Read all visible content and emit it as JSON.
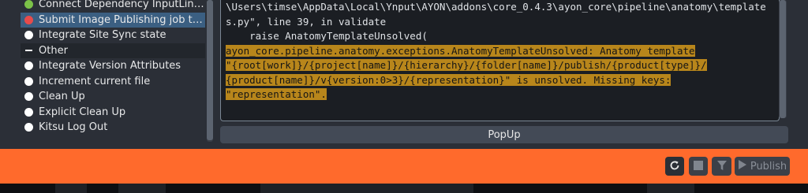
{
  "plugins": [
    {
      "label": "Connect Dependency InputLinks ...",
      "state": "success",
      "color": "#7bc148"
    },
    {
      "label": "Submit Image Publishing job to D...",
      "state": "error",
      "color": "#e84b4b",
      "selected": true
    },
    {
      "label": "Integrate Site Sync state",
      "state": "pending",
      "color": "#ffffff"
    },
    {
      "label": "Other",
      "state": "group",
      "color": "#ffffff",
      "current": true
    },
    {
      "label": "Integrate Version Attributes",
      "state": "pending",
      "color": "#ffffff"
    },
    {
      "label": "Increment current file",
      "state": "pending",
      "color": "#ffffff"
    },
    {
      "label": "Clean Up",
      "state": "pending",
      "color": "#ffffff"
    },
    {
      "label": "Explicit Clean Up",
      "state": "pending",
      "color": "#ffffff"
    },
    {
      "label": "Kitsu Log Out",
      "state": "pending",
      "color": "#ffffff"
    }
  ],
  "log": {
    "lines": [
      {
        "text": "\\Users\\timse\\AppData\\Local\\Ynput\\AYON\\addons\\core_0.4.3\\ayon_core\\pipeline\\anatomy\\template",
        "highlight": false
      },
      {
        "text": "s.py\", line 39, in validate",
        "highlight": false
      },
      {
        "text": "    raise AnatomyTemplateUnsolved(",
        "highlight": false
      },
      {
        "text": "ayon_core.pipeline.anatomy.exceptions.AnatomyTemplateUnsolved: Anatomy template",
        "highlight": true
      },
      {
        "text": "\"{root[work]}/{project[name]}/{hierarchy}/{folder[name]}/publish/{product[type]}/",
        "highlight": true
      },
      {
        "text": "{product[name]}/v{version:0>3}/{representation}\" is unsolved. Missing keys:",
        "highlight": true
      },
      {
        "text": "\"representation\".",
        "highlight": true
      }
    ],
    "highlight_color": "#b8861b"
  },
  "popup": {
    "label": "PopUp"
  },
  "footer": {
    "background": "#ff6a2c",
    "reset_icon": "refresh-icon",
    "stop_icon": "stop-icon",
    "filter_icon": "filter-icon",
    "publish_label": "Publish",
    "publish_icon": "play-icon"
  }
}
